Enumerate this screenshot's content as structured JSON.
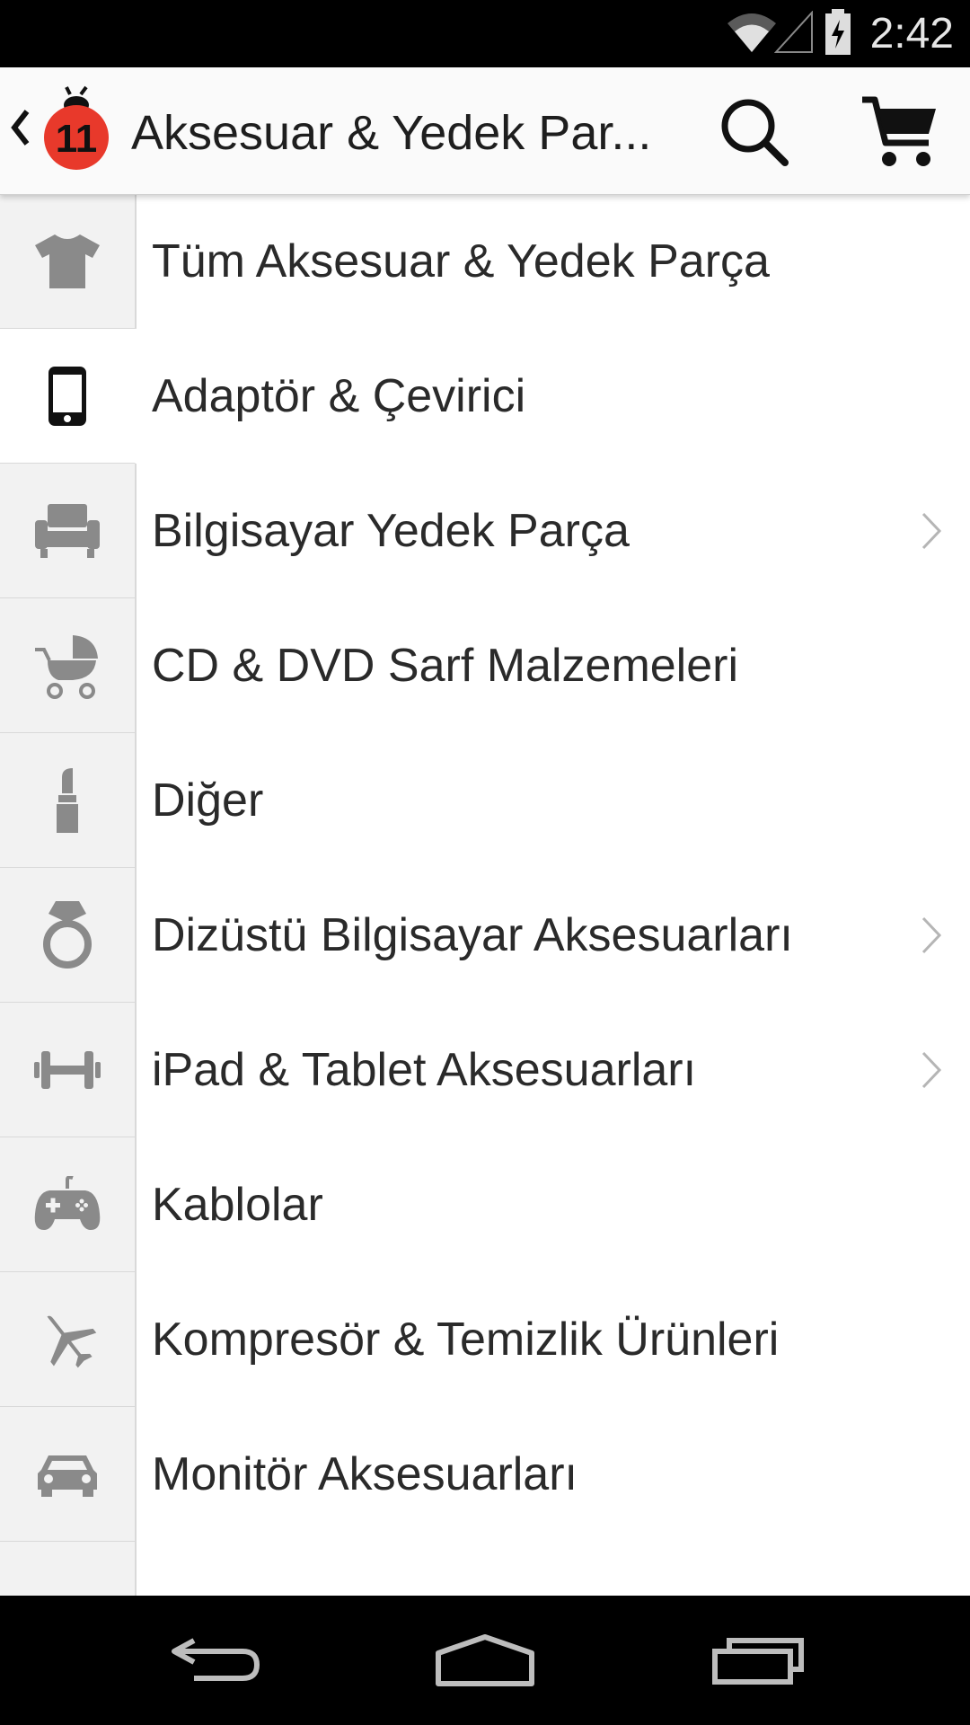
{
  "status_bar": {
    "time": "2:42",
    "icons": [
      "wifi-icon",
      "signal-icon",
      "battery-charging-icon"
    ]
  },
  "app_bar": {
    "title": "Aksesuar & Yedek Par...",
    "icons": [
      "back-chevron-icon",
      "ladybug-11-logo",
      "search-icon",
      "cart-icon"
    ]
  },
  "categories": [
    {
      "label": "Tüm Aksesuar & Yedek Parça",
      "icon": "tshirt-icon",
      "has_children": false,
      "active": false
    },
    {
      "label": "Adaptör & Çevirici",
      "icon": "phone-icon",
      "has_children": false,
      "active": true
    },
    {
      "label": "Bilgisayar Yedek Parça",
      "icon": "armchair-icon",
      "has_children": true,
      "active": false
    },
    {
      "label": "CD & DVD Sarf Malzemeleri",
      "icon": "stroller-icon",
      "has_children": false,
      "active": false
    },
    {
      "label": "Diğer",
      "icon": "lipstick-icon",
      "has_children": false,
      "active": false
    },
    {
      "label": "Dizüstü Bilgisayar Aksesuarları",
      "icon": "ring-icon",
      "has_children": true,
      "active": false
    },
    {
      "label": "iPad & Tablet Aksesuarları",
      "icon": "dumbbell-icon",
      "has_children": true,
      "active": false
    },
    {
      "label": "Kablolar",
      "icon": "gamepad-icon",
      "has_children": false,
      "active": false
    },
    {
      "label": "Kompresör & Temizlik Ürünleri",
      "icon": "airplane-icon",
      "has_children": false,
      "active": false
    },
    {
      "label": "Monitör Aksesuarları",
      "icon": "car-icon",
      "has_children": false,
      "active": false
    },
    {
      "label": "",
      "icon": "",
      "has_children": false,
      "active": false
    }
  ],
  "nav_bar": {
    "buttons": [
      "back-nav-icon",
      "home-nav-icon",
      "recents-nav-icon"
    ]
  },
  "colors": {
    "logo_red": "#e8392b",
    "icon_gray": "#8a8a8a",
    "text": "#2a2a2a"
  }
}
